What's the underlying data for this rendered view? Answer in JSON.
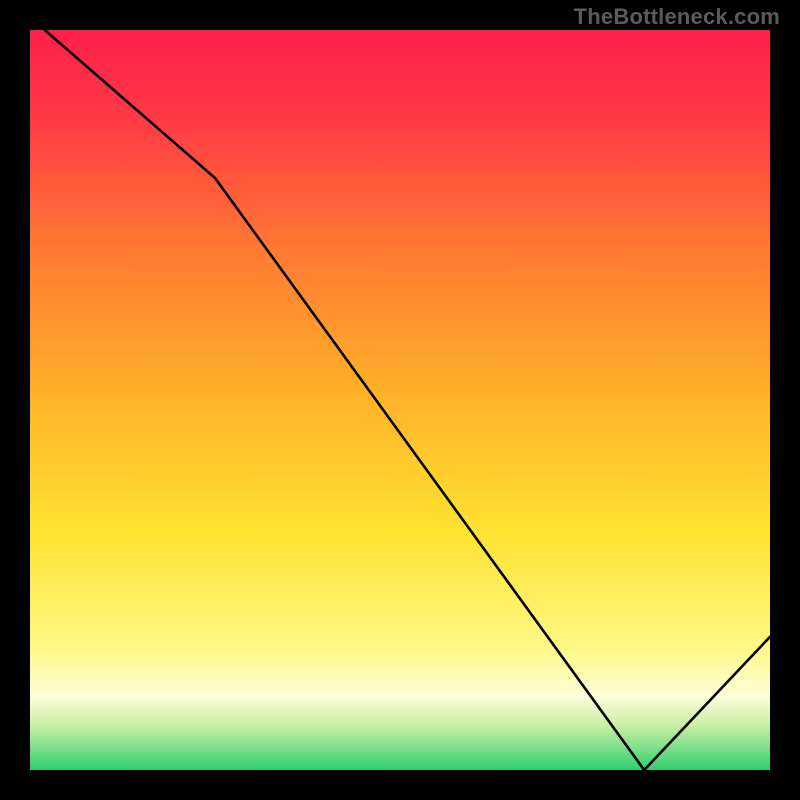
{
  "attribution": "TheBottleneck.com",
  "zone_label": "",
  "colors": {
    "black": "#000000",
    "top_red": "#ff1f4b",
    "mid_yellow": "#ffd92e",
    "near_white": "#fdfdda",
    "green": "#2ecf6e",
    "attribution_gray": "#5b5b5b",
    "zone_text": "#9d4a4a"
  },
  "chart_data": {
    "type": "line",
    "title": "",
    "xlabel": "",
    "ylabel": "",
    "xlim": [
      0,
      100
    ],
    "ylim": [
      0,
      100
    ],
    "grid": false,
    "legend": false,
    "series": [
      {
        "name": "curve",
        "x": [
          2,
          25,
          83,
          100
        ],
        "y": [
          100,
          80,
          0,
          18
        ]
      }
    ],
    "notes": "Background is a vertical multi-stop gradient (red→orange→yellow→pale→green). Minimum of the curve is near x≈83; 'optimal' label sits near the minimum. Axes are unlabeled (black frame)."
  }
}
